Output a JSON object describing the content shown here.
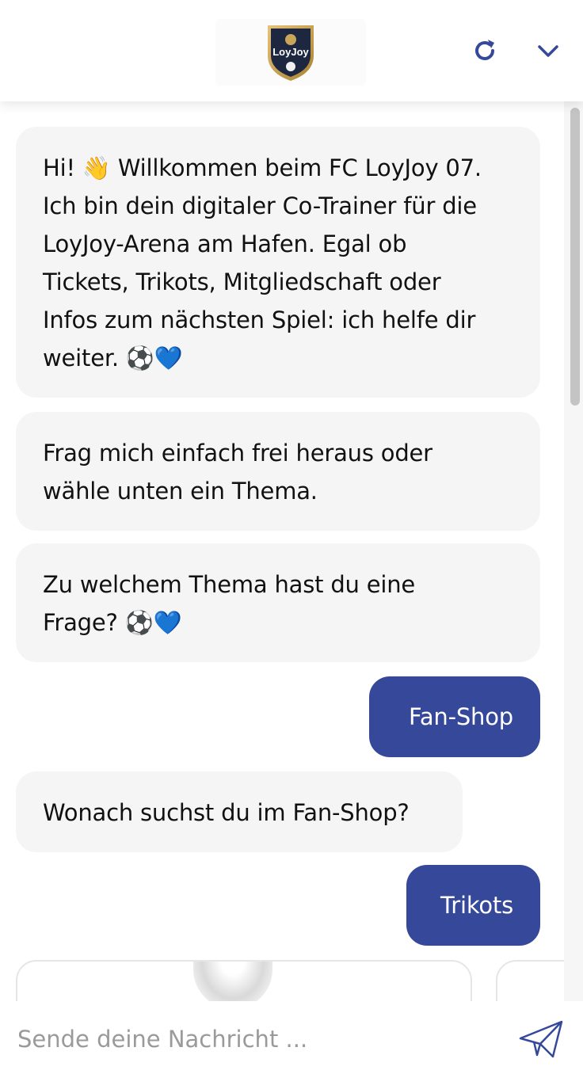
{
  "header": {
    "logo_text": "LoyJoy",
    "refresh_icon": "refresh-icon",
    "collapse_icon": "chevron-down-icon",
    "accent_color": "#35489a"
  },
  "messages": [
    {
      "sender": "bot",
      "lines": [
        "Hi! 👋 Willkommen beim FC LoyJoy 07.",
        "Ich bin dein digitaler Co-Trainer für die",
        "LoyJoy-Arena am Hafen. Egal ob",
        "Tickets, Trikots, Mitgliedschaft oder",
        "Infos zum nächsten Spiel: ich helfe dir",
        "weiter. ⚽💙"
      ]
    },
    {
      "sender": "bot",
      "lines": [
        "Frag mich einfach frei heraus oder",
        "wähle unten ein Thema."
      ]
    },
    {
      "sender": "bot",
      "lines": [
        "Zu welchem Thema hast du eine",
        "Frage? ⚽💙"
      ]
    },
    {
      "sender": "user",
      "text": "Fan-Shop"
    },
    {
      "sender": "bot",
      "lines": [
        "Wonach suchst du im Fan-Shop?"
      ]
    },
    {
      "sender": "user",
      "text": "Trikots"
    }
  ],
  "input": {
    "placeholder": "Sende deine Nachricht ...",
    "value": "",
    "send_icon": "paper-plane-icon"
  }
}
